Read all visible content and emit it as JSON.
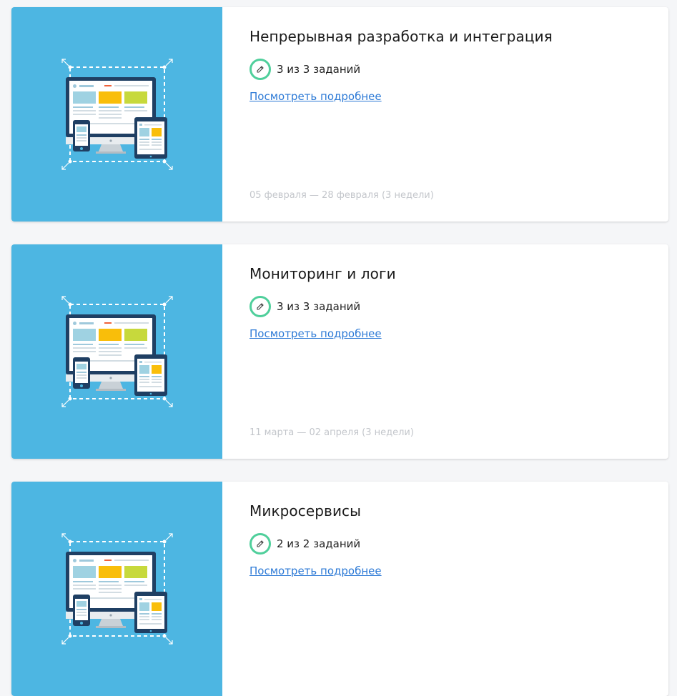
{
  "colors": {
    "page_bg": "#f5f6f8",
    "card_image_bg": "#4db6e2",
    "badge_ring": "#4fcf9b",
    "link": "#2d7ad6",
    "dates": "#c3c6cb"
  },
  "courses": [
    {
      "title": "Непрерывная разработка и интеграция",
      "tasks": "3 из 3 заданий",
      "link_label": "Посмотреть подробнее",
      "dates": "05 февраля — 28 февраля (3 недели)",
      "image_icon": "responsive-devices-illustration",
      "badge_icon": "edit-icon"
    },
    {
      "title": "Мониторинг и логи",
      "tasks": "3 из 3 заданий",
      "link_label": "Посмотреть подробнее",
      "dates": "11 марта — 02 апреля (3 недели)",
      "image_icon": "responsive-devices-illustration",
      "badge_icon": "edit-icon"
    },
    {
      "title": "Микросервисы",
      "tasks": "2 из 2 заданий",
      "link_label": "Посмотреть подробнее",
      "dates": "",
      "image_icon": "responsive-devices-illustration",
      "badge_icon": "edit-icon"
    }
  ]
}
